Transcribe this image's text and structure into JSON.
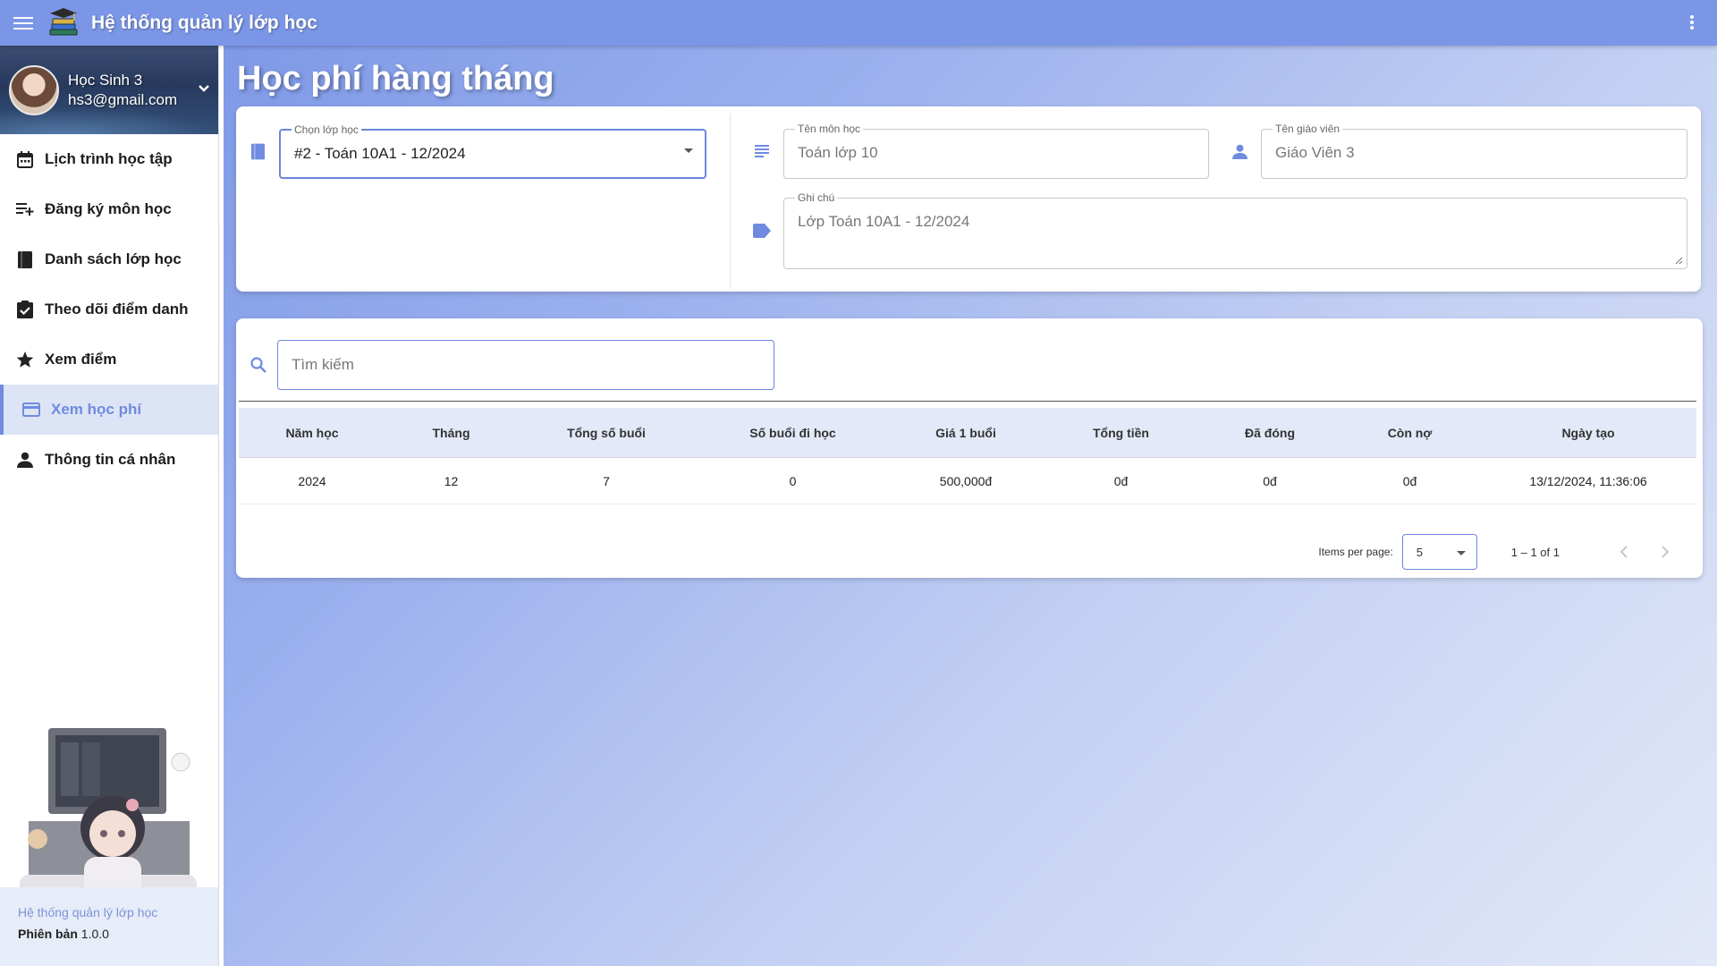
{
  "app": {
    "title": "Hệ thống quản lý lớp học",
    "icons": {
      "menu": "menu-icon",
      "more": "more-vert-icon",
      "logo": "books-graduation-cap-logo"
    },
    "accent": "#7b96e6",
    "active_color": "#6f8be0"
  },
  "user": {
    "name": "Học Sinh 3",
    "email": "hs3@gmail.com"
  },
  "sidebar": {
    "items": [
      {
        "label": "Lịch trình học tập",
        "icon": "calendar-icon",
        "active": false
      },
      {
        "label": "Đăng ký môn học",
        "icon": "playlist-add-icon",
        "active": false
      },
      {
        "label": "Danh sách lớp học",
        "icon": "book-icon",
        "active": false
      },
      {
        "label": "Theo dõi điểm danh",
        "icon": "clipboard-check-icon",
        "active": false
      },
      {
        "label": "Xem điểm",
        "icon": "star-icon",
        "active": false
      },
      {
        "label": "Xem học phí",
        "icon": "credit-card-icon",
        "active": true
      },
      {
        "label": "Thông tin cá nhân",
        "icon": "person-icon",
        "active": false
      }
    ],
    "footer": {
      "title": "Hệ thống quản lý lớp học",
      "version_label": "Phiên bản",
      "version": "1.0.0"
    }
  },
  "page": {
    "title": "Học phí hàng tháng"
  },
  "form": {
    "class_select": {
      "label": "Chọn lớp học",
      "value": "#2 - Toán 10A1 - 12/2024",
      "icon": "book-icon"
    },
    "subject": {
      "label": "Tên môn học",
      "value": "Toán lớp 10",
      "icon": "notes-icon"
    },
    "teacher": {
      "label": "Tên giáo viên",
      "value": "Giáo Viên 3",
      "icon": "person-icon"
    },
    "note": {
      "label": "Ghi chú",
      "value": "Lớp Toán 10A1 - 12/2024",
      "icon": "label-icon"
    }
  },
  "search": {
    "placeholder": "Tìm kiếm",
    "icon": "search-icon"
  },
  "table": {
    "columns": [
      "Năm học",
      "Tháng",
      "Tổng số buổi",
      "Số buổi đi học",
      "Giá 1 buổi",
      "Tổng tiền",
      "Đã đóng",
      "Còn nợ",
      "Ngày tạo"
    ],
    "rows": [
      [
        "2024",
        "12",
        "7",
        "0",
        "500,000đ",
        "0đ",
        "0đ",
        "0đ",
        "13/12/2024, 11:36:06"
      ]
    ]
  },
  "pagination": {
    "items_per_page_label": "Items per page:",
    "items_per_page": "5",
    "range": "1 – 1 of 1"
  }
}
